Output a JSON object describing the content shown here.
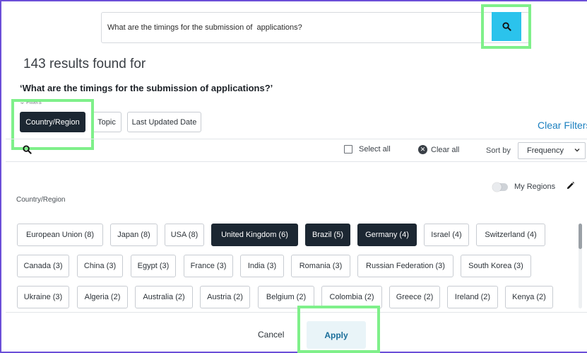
{
  "search": {
    "value": "What are the timings for the submission of  applications?"
  },
  "results": {
    "count_text": "143 results found for",
    "query_text": "‘What are the timings for the submission of  applications?’"
  },
  "filters": {
    "label": "Filters",
    "tabs": [
      {
        "label": "Country/Region",
        "active": true
      },
      {
        "label": "Topic",
        "active": false
      },
      {
        "label": "Last Updated Date",
        "active": false
      }
    ],
    "clear_filters": "Clear Filters"
  },
  "toolbar": {
    "select_all": "Select all",
    "clear_all": "Clear all",
    "sort_by": "Sort by",
    "sort_value": "Frequency"
  },
  "regions": {
    "my_regions": "My Regions",
    "my_regions_on": false,
    "section_label": "Country/Region",
    "rows": [
      [
        {
          "label": "European Union (8)",
          "selected": false
        },
        {
          "label": "Japan (8)",
          "selected": false
        },
        {
          "label": "USA (8)",
          "selected": false
        },
        {
          "label": "United Kingdom (6)",
          "selected": true
        },
        {
          "label": "Brazil (5)",
          "selected": true
        },
        {
          "label": "Germany (4)",
          "selected": true
        },
        {
          "label": "Israel (4)",
          "selected": false
        },
        {
          "label": "Switzerland (4)",
          "selected": false
        }
      ],
      [
        {
          "label": "Canada (3)",
          "selected": false
        },
        {
          "label": "China (3)",
          "selected": false
        },
        {
          "label": "Egypt (3)",
          "selected": false
        },
        {
          "label": "France (3)",
          "selected": false
        },
        {
          "label": "India (3)",
          "selected": false
        },
        {
          "label": "Romania (3)",
          "selected": false
        },
        {
          "label": "Russian Federation (3)",
          "selected": false
        },
        {
          "label": "South Korea (3)",
          "selected": false
        }
      ],
      [
        {
          "label": "Ukraine (3)",
          "selected": false
        },
        {
          "label": "Algeria (2)",
          "selected": false
        },
        {
          "label": "Australia (2)",
          "selected": false
        },
        {
          "label": "Austria (2)",
          "selected": false
        },
        {
          "label": "Belgium (2)",
          "selected": false
        },
        {
          "label": "Colombia (2)",
          "selected": false
        },
        {
          "label": "Greece (2)",
          "selected": false
        },
        {
          "label": "Ireland (2)",
          "selected": false
        },
        {
          "label": "Kenya (2)",
          "selected": false
        }
      ]
    ]
  },
  "footer": {
    "cancel": "Cancel",
    "apply": "Apply"
  },
  "colors": {
    "accent": "#2bc3ec",
    "selected_chip": "#1c2732",
    "link": "#1a7fbf",
    "highlight": "#7ff08a"
  }
}
